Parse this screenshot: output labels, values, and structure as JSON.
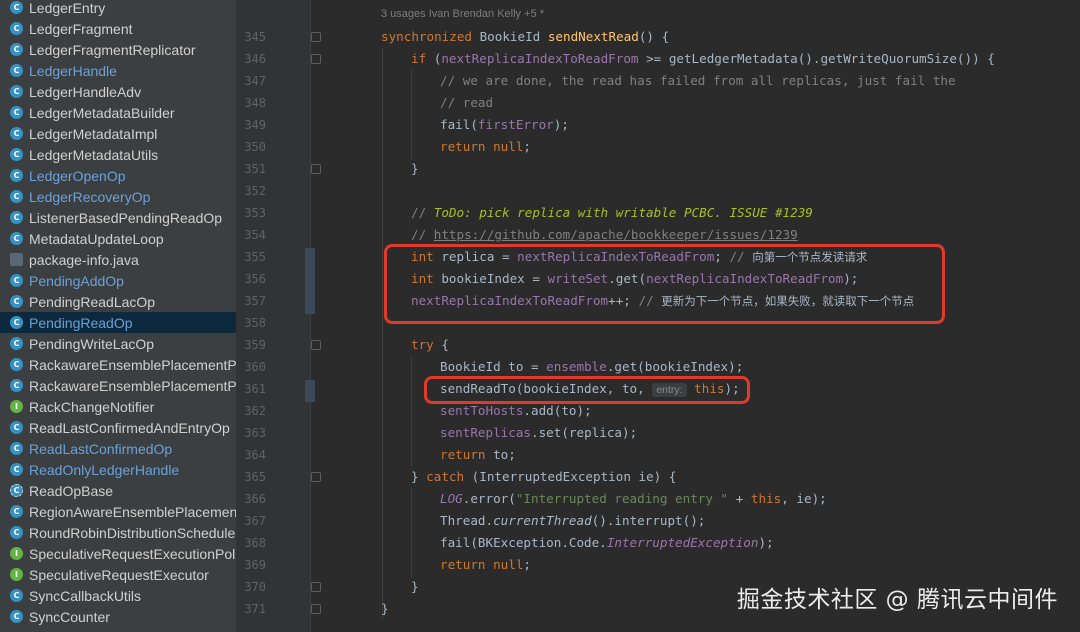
{
  "project_tree": {
    "items": [
      {
        "label": "LedgerEntry",
        "icon": "class",
        "link": false
      },
      {
        "label": "LedgerFragment",
        "icon": "class",
        "link": false
      },
      {
        "label": "LedgerFragmentReplicator",
        "icon": "class",
        "link": false
      },
      {
        "label": "LedgerHandle",
        "icon": "class",
        "link": true
      },
      {
        "label": "LedgerHandleAdv",
        "icon": "class",
        "link": false
      },
      {
        "label": "LedgerMetadataBuilder",
        "icon": "class",
        "link": false
      },
      {
        "label": "LedgerMetadataImpl",
        "icon": "class",
        "link": false
      },
      {
        "label": "LedgerMetadataUtils",
        "icon": "class",
        "link": false
      },
      {
        "label": "LedgerOpenOp",
        "icon": "class",
        "link": true
      },
      {
        "label": "LedgerRecoveryOp",
        "icon": "class",
        "link": true
      },
      {
        "label": "ListenerBasedPendingReadOp",
        "icon": "class",
        "link": false
      },
      {
        "label": "MetadataUpdateLoop",
        "icon": "class",
        "link": false
      },
      {
        "label": "package-info.java",
        "icon": "java",
        "link": false
      },
      {
        "label": "PendingAddOp",
        "icon": "class",
        "link": true
      },
      {
        "label": "PendingReadLacOp",
        "icon": "class",
        "link": false
      },
      {
        "label": "PendingReadOp",
        "icon": "class",
        "link": true,
        "selected": true
      },
      {
        "label": "PendingWriteLacOp",
        "icon": "class",
        "link": false
      },
      {
        "label": "RackawareEnsemblePlacementP",
        "icon": "class",
        "link": false
      },
      {
        "label": "RackawareEnsemblePlacementP",
        "icon": "class",
        "link": false
      },
      {
        "label": "RackChangeNotifier",
        "icon": "interface",
        "link": false
      },
      {
        "label": "ReadLastConfirmedAndEntryOp",
        "icon": "class",
        "link": false
      },
      {
        "label": "ReadLastConfirmedOp",
        "icon": "class",
        "link": true
      },
      {
        "label": "ReadOnlyLedgerHandle",
        "icon": "class",
        "link": true
      },
      {
        "label": "ReadOpBase",
        "icon": "abstract",
        "link": false
      },
      {
        "label": "RegionAwareEnsemblePlacemen",
        "icon": "class",
        "link": false
      },
      {
        "label": "RoundRobinDistributionSchedule",
        "icon": "class",
        "link": false
      },
      {
        "label": "SpeculativeRequestExecutionPol",
        "icon": "interface",
        "link": false
      },
      {
        "label": "SpeculativeRequestExecutor",
        "icon": "interface",
        "link": false
      },
      {
        "label": "SyncCallbackUtils",
        "icon": "class",
        "link": false
      },
      {
        "label": "SyncCounter",
        "icon": "class",
        "link": false
      }
    ]
  },
  "editor": {
    "usages_hint": "3 usages   Ivan Brendan Kelly +5 *",
    "line_numbers": [
      "345",
      "346",
      "347",
      "348",
      "349",
      "350",
      "351",
      "352",
      "353",
      "354",
      "355",
      "356",
      "357",
      "358",
      "359",
      "360",
      "361",
      "362",
      "363",
      "364",
      "365",
      "366",
      "367",
      "368",
      "369",
      "370",
      "371"
    ],
    "code": {
      "l345": {
        "kw": "synchronized",
        "type": " BookieId ",
        "fn": "sendNextRead",
        "rest": "() {"
      },
      "l346": {
        "kw": "if",
        "a": " (",
        "f1": "nextReplicaIndexToReadFrom",
        "b": " >= getLedgerMetadata().getWriteQuorumSize()) {"
      },
      "l347": {
        "cm": "// we are done, the read has failed from all replicas, just fail the"
      },
      "l348": {
        "cm": "// read"
      },
      "l349": {
        "a": "fail(",
        "f1": "firstError",
        "b": ");"
      },
      "l350": {
        "kw": "return null",
        "b": ";"
      },
      "l351": {
        "a": "}"
      },
      "l353": {
        "cm": "// ",
        "todo": "ToDo: pick replica with writable PCBC. ISSUE #1239"
      },
      "l354": {
        "cm": "// ",
        "url": "https://github.com/apache/bookkeeper/issues/1239"
      },
      "l355": {
        "kw": "int",
        "a": " replica = ",
        "f1": "nextReplicaIndexToReadFrom",
        "b": "; ",
        "cm": "// ",
        "zh": "向第一个节点发读请求"
      },
      "l356": {
        "kw": "int",
        "a": " bookieIndex = ",
        "f1": "writeSet",
        "b": ".get(",
        "f2": "nextReplicaIndexToReadFrom",
        "c": ");"
      },
      "l357": {
        "f1": "nextReplicaIndexToReadFrom",
        "b": "++; ",
        "cm": "// ",
        "zh": "更新为下一个节点，如果失败，就读取下一个节点"
      },
      "l359": {
        "kw": "try",
        "b": " {"
      },
      "l360": {
        "a": "BookieId to = ",
        "f1": "ensemble",
        "b": ".get(bookieIndex);"
      },
      "l361": {
        "a": "sendReadTo(bookieIndex, to, ",
        "hint": "entry:",
        "kw": "this",
        "b": ");"
      },
      "l362": {
        "f1": "sentToHosts",
        "b": ".add(to);"
      },
      "l363": {
        "f1": "sentReplicas",
        "b": ".set(replica);"
      },
      "l364": {
        "kw": "return",
        "b": " to;"
      },
      "l365": {
        "a": "} ",
        "kw": "catch",
        "b": " (InterruptedException ie) {"
      },
      "l366": {
        "f1": "LOG",
        "a": ".error(",
        "str": "\"Interrupted reading entry \"",
        "b": " + ",
        "kw": "this",
        "c": ", ie);"
      },
      "l367": {
        "a": "Thread.",
        "it": "currentThread",
        "b": "().interrupt();"
      },
      "l368": {
        "a": "fail(BKException.Code.",
        "f1": "InterruptedException",
        "b": ");"
      },
      "l369": {
        "kw": "return null",
        "b": ";"
      },
      "l370": {
        "a": "}"
      },
      "l371": {
        "a": "}"
      }
    }
  },
  "watermark": "掘金技术社区 @ 腾讯云中间件",
  "colors": {
    "keyword": "#cc7832",
    "method": "#ffc66d",
    "field": "#9876aa",
    "comment": "#808080",
    "todo": "#a8c023",
    "string": "#6a8759",
    "highlight_box": "#e03a2a",
    "selected_row": "#0d293e"
  }
}
